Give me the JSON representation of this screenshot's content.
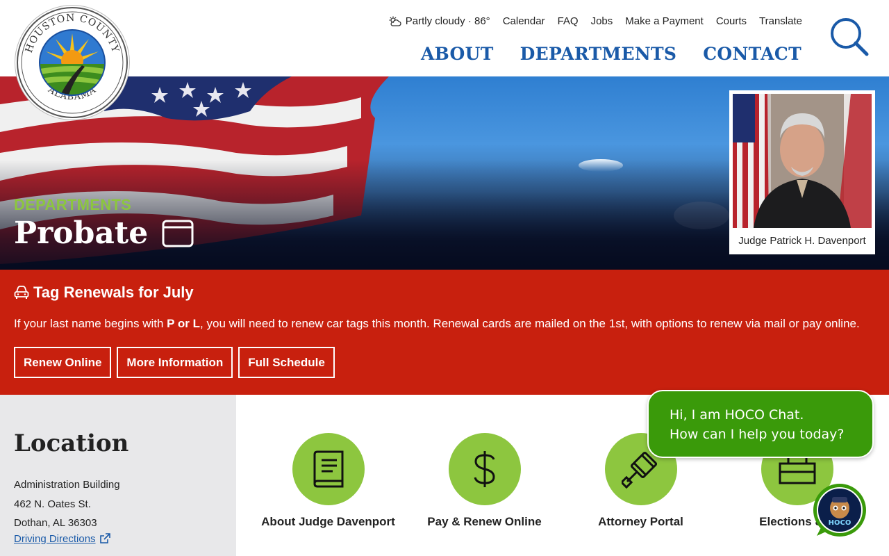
{
  "header": {
    "logo_top_text": "HOUSTON COUNTY",
    "logo_bottom_text": "ALABAMA",
    "weather": "Partly cloudy · 86°",
    "utility_links": [
      "Calendar",
      "FAQ",
      "Jobs",
      "Make a Payment",
      "Courts",
      "Translate"
    ],
    "main_nav": [
      "ABOUT",
      "DEPARTMENTS",
      "CONTACT"
    ]
  },
  "hero": {
    "subtitle": "DEPARTMENTS",
    "title": "Probate",
    "judge_caption": "Judge Patrick H. Davenport"
  },
  "alert": {
    "title": "Tag Renewals for July",
    "text_before": "If your last name begins with ",
    "text_bold": "P or L",
    "text_after": ", you will need to renew car tags this month. Renewal cards are mailed on the 1st, with options to renew via mail or pay online.",
    "buttons": [
      "Renew Online",
      "More Information",
      "Full Schedule"
    ]
  },
  "location": {
    "heading": "Location",
    "lines": [
      "Administration Building",
      "462 N. Oates St.",
      "Dothan, AL 36303"
    ],
    "directions_link": "Driving Directions"
  },
  "quick_links": [
    {
      "label": "About Judge Davenport",
      "icon": "book-icon"
    },
    {
      "label": "Pay & Renew Online",
      "icon": "dollar-icon"
    },
    {
      "label": "Attorney Portal",
      "icon": "gavel-icon"
    },
    {
      "label": "Elections & V",
      "icon": "ballot-box-icon"
    }
  ],
  "chat": {
    "line1": "Hi, I am HOCO Chat.",
    "line2": "How can I help you today?",
    "avatar_text": "HOCO"
  },
  "colors": {
    "nav_blue": "#1a5aa8",
    "accent_green": "#8dc63f",
    "alert_red": "#c8200e",
    "chat_green": "#3a9a0a"
  }
}
